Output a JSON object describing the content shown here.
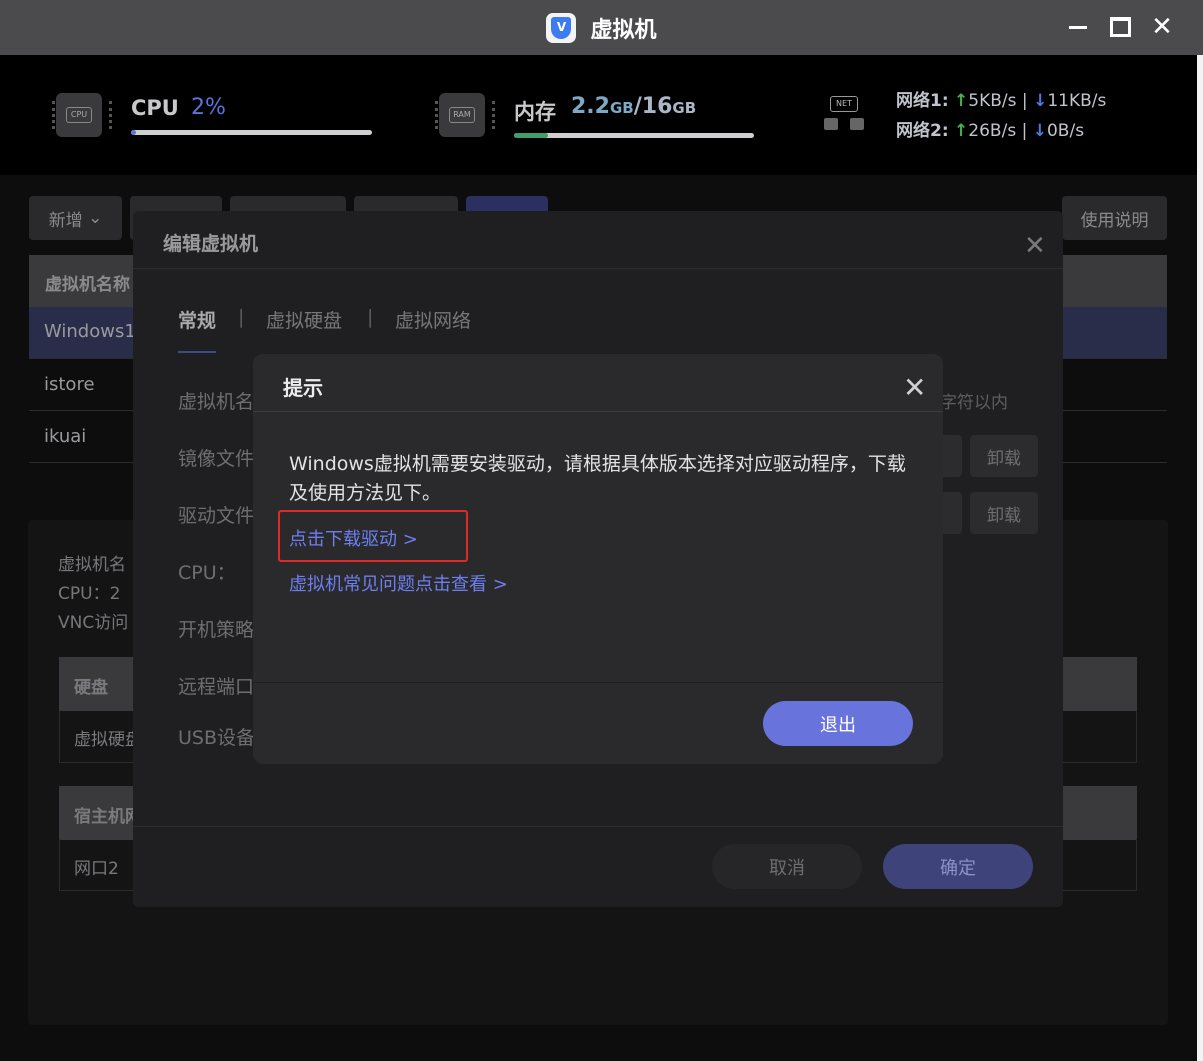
{
  "window": {
    "title": "虚拟机"
  },
  "stats": {
    "cpu": {
      "label": "CPU",
      "value": "2%",
      "fraction": 0.02
    },
    "memory": {
      "label": "内存",
      "used": "2.2",
      "used_unit": "GB",
      "sep": "/",
      "total": "16",
      "total_unit": "GB",
      "fraction": 0.14
    },
    "network": [
      {
        "name": "网络1:",
        "up": "5KB/s",
        "down": "11KB/s"
      },
      {
        "name": "网络2:",
        "up": "26B/s",
        "down": "0B/s"
      }
    ],
    "chip_labels": {
      "cpu": "CPU",
      "ram": "RAM",
      "net": "NET"
    }
  },
  "toolbar": {
    "new_label": "新增",
    "help_label": "使用说明"
  },
  "vm_table": {
    "header": "虚拟机名称",
    "rows": [
      "Windows1",
      "istore",
      "ikuai"
    ]
  },
  "details": {
    "name_label": "虚拟机名",
    "cpu_text": "CPU：2",
    "vnc_label": "VNC访问",
    "disk_header": "硬盘",
    "disk_row": "虚拟硬盘",
    "host_header": "宿主机网",
    "host_row": "网口2"
  },
  "edit_dialog": {
    "title": "编辑虚拟机",
    "tabs": [
      "常规",
      "虚拟硬盘",
      "虚拟网络"
    ],
    "tab_sep": "|",
    "labels": [
      "虚拟机名",
      "镜像文件",
      "驱动文件",
      "CPU：",
      "开机策略",
      "远程端口",
      "USB设备"
    ],
    "name_hint": "字符以内",
    "unload_label": "卸载",
    "cancel_label": "取消",
    "ok_label": "确定"
  },
  "hint_dialog": {
    "title": "提示",
    "message": "Windows虚拟机需要安装驱动，请根据具体版本选择对应驱动程序，下载及使用方法见下。",
    "link_download": "点击下载驱动 >",
    "link_faq": "虚拟机常见问题点击查看 >",
    "exit_label": "退出"
  },
  "colors": {
    "accent": "#6873dc",
    "highlight_box": "#e02a2a",
    "up_arrow": "#47b04b",
    "down_arrow": "#4b7be0"
  }
}
